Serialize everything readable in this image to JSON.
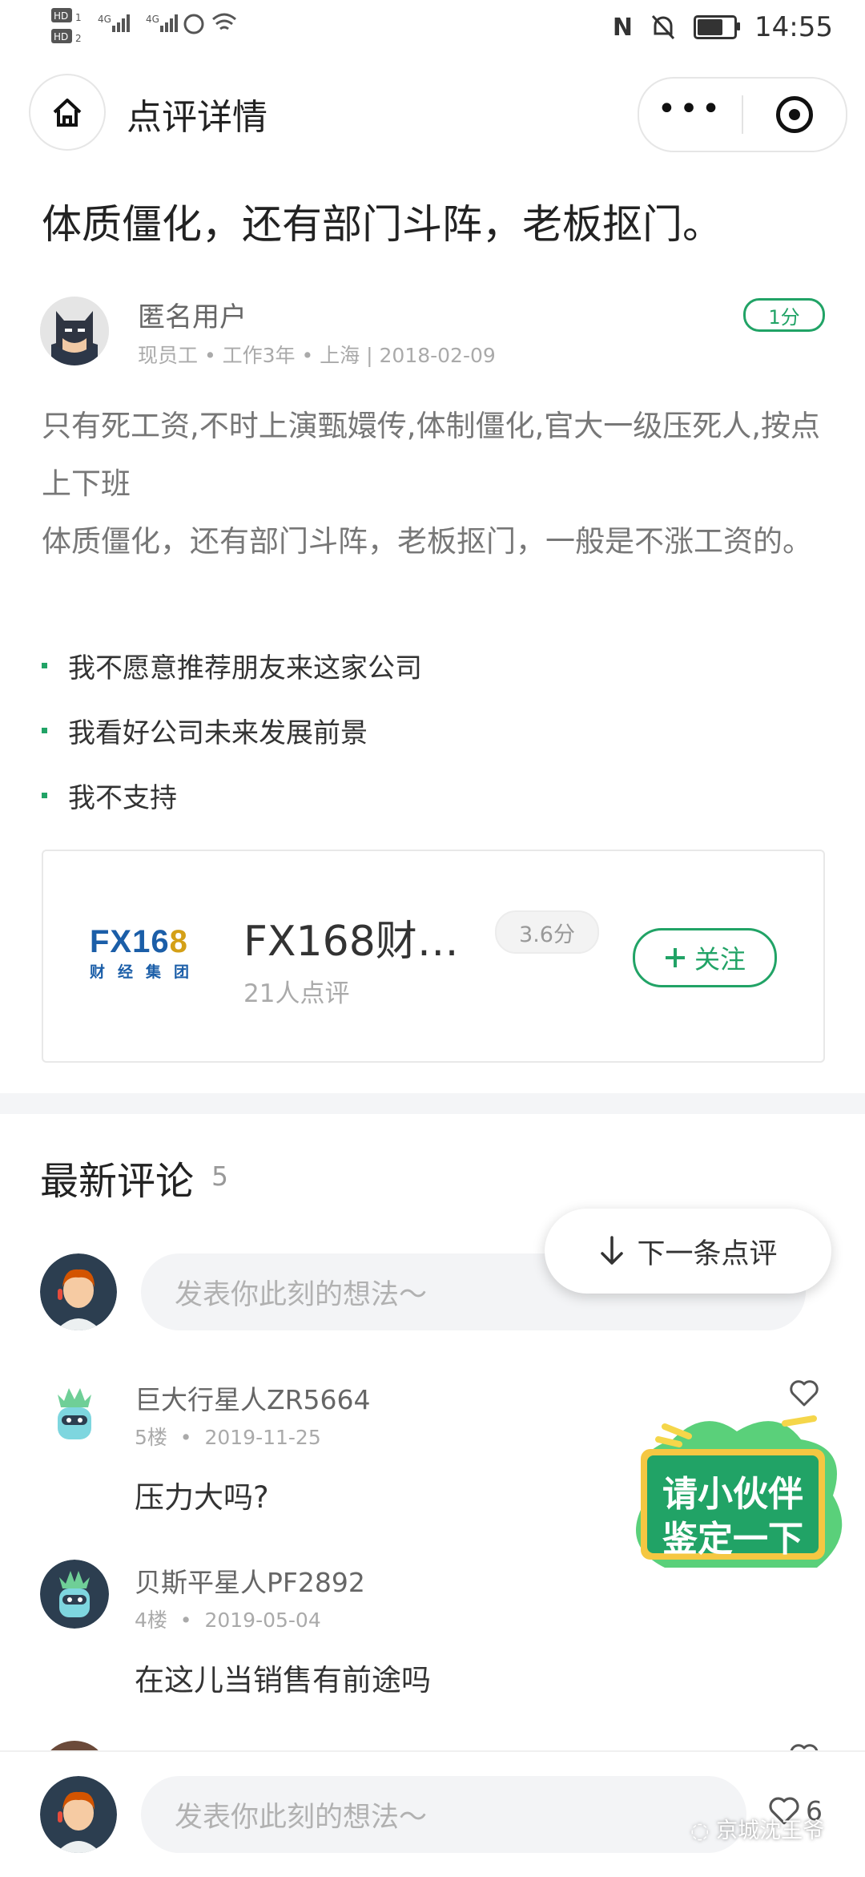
{
  "status_bar": {
    "left": "HD1 4G 4G",
    "time": "14:55"
  },
  "nav": {
    "title": "点评详情"
  },
  "review": {
    "title": "体质僵化，还有部门斗阵，老板抠门。",
    "user": "匿名用户",
    "meta": "现员工 • 工作3年 • 上海 | 2018-02-09",
    "score": "1分",
    "body_line1": "只有死工资,不时上演甄嬛传,体制僵化,官大一级压死人,按点上下班",
    "body_line2": "体质僵化，还有部门斗阵，老板抠门，一般是不涨工资的。",
    "bullets": [
      "我不愿意推荐朋友来这家公司",
      "我看好公司未来发展前景",
      "我不支持"
    ]
  },
  "company": {
    "logo_text": "FX168",
    "logo_sub": "财经集团",
    "name": "FX168财…",
    "score": "3.6分",
    "reviews": "21人点评",
    "follow_label": "关注"
  },
  "comments": {
    "title": "最新评论",
    "count": "5",
    "input_placeholder": "发表你此刻的想法～",
    "next_label": "下一条点评",
    "items": [
      {
        "name": "巨大行星人ZR5664",
        "floor": "5楼",
        "date": "2019-11-25",
        "text": "压力大吗?"
      },
      {
        "name": "贝斯平星人PF2892",
        "floor": "4楼",
        "date": "2019-05-04",
        "text": "在这儿当销售有前途吗"
      }
    ]
  },
  "promo": {
    "line1": "请小伙伴",
    "line2": "鉴定一下"
  },
  "bottom": {
    "placeholder": "发表你此刻的想法～",
    "likes": "6"
  },
  "watermark": "京城沈王爷",
  "colors": {
    "accent": "#21a366",
    "logo_blue": "#1b5ea8",
    "logo_gold": "#d4a017"
  }
}
